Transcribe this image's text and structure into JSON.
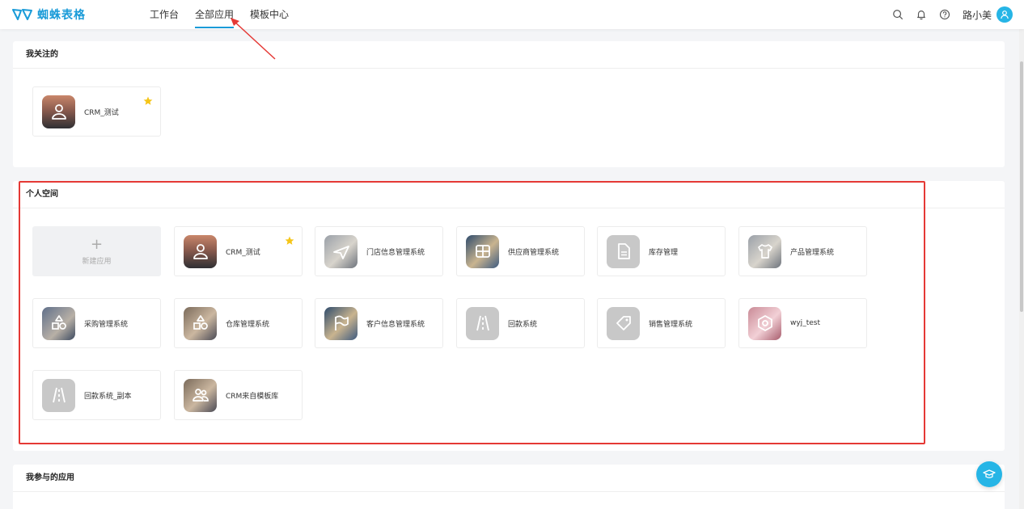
{
  "brand": {
    "name": "蜘蛛表格",
    "color": "#1a9bd8"
  },
  "nav": {
    "tabs": [
      {
        "label": "工作台",
        "active": false
      },
      {
        "label": "全部应用",
        "active": true
      },
      {
        "label": "模板中心",
        "active": false
      }
    ]
  },
  "toolbar": {
    "icons": [
      "search-icon",
      "bell-icon",
      "help-icon"
    ],
    "user_name": "路小美"
  },
  "sections": {
    "favorites": {
      "title": "我关注的",
      "apps": [
        {
          "name": "CRM_测试",
          "icon": "user-icon",
          "starred": true
        }
      ]
    },
    "personal": {
      "title": "个人空间",
      "new_app_label": "新建应用",
      "new_app_symbol": "+",
      "apps": [
        {
          "name": "CRM_测试",
          "icon": "user-icon",
          "starred": true
        },
        {
          "name": "门店信息管理系统",
          "icon": "plane-icon",
          "starred": false
        },
        {
          "name": "供应商管理系统",
          "icon": "grid-icon",
          "starred": false
        },
        {
          "name": "库存管理",
          "icon": "document-icon",
          "starred": false
        },
        {
          "name": "产品管理系统",
          "icon": "shirt-icon",
          "starred": false
        },
        {
          "name": "采购管理系统",
          "icon": "shapes-icon",
          "starred": false
        },
        {
          "name": "仓库管理系统",
          "icon": "shapes-icon",
          "starred": false
        },
        {
          "name": "客户信息管理系统",
          "icon": "flag-icon",
          "starred": false
        },
        {
          "name": "回款系统",
          "icon": "road-icon",
          "starred": false
        },
        {
          "name": "销售管理系统",
          "icon": "tag-icon",
          "starred": false
        },
        {
          "name": "wyj_test",
          "icon": "hexagon-icon",
          "starred": false
        },
        {
          "name": "回款系统_副本",
          "icon": "road-icon",
          "starred": false
        },
        {
          "name": "CRM来自模板库",
          "icon": "users-icon",
          "starred": false
        }
      ]
    },
    "joined": {
      "title": "我参与的应用"
    }
  },
  "colors": {
    "accent": "#1a9bd8",
    "star": "#f5c518",
    "annotation": "#e53935"
  }
}
